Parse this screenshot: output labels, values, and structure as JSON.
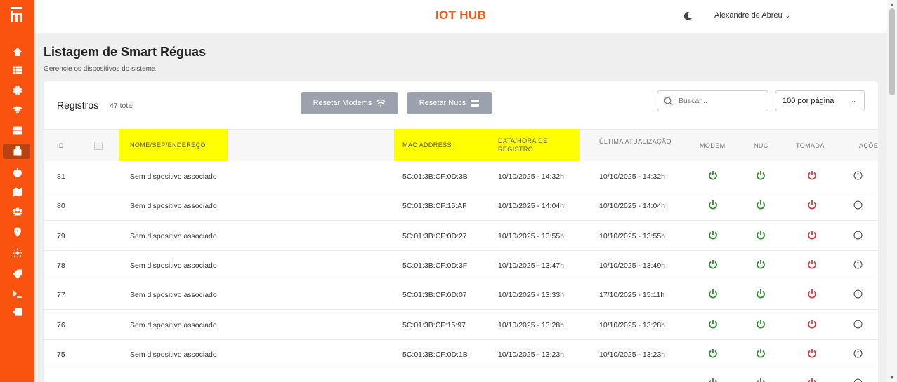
{
  "header": {
    "title": "IOT HUB",
    "user_name": "Alexandre de Abreu"
  },
  "page": {
    "title": "Listagem de Smart Réguas",
    "subtitle": "Gerencie os dispositivos do sistema"
  },
  "toolbar": {
    "registros_label": "Registros",
    "total_label": "47 total",
    "reset_modems_label": "Resetar Modems",
    "reset_nucs_label": "Resetar Nucs",
    "search_placeholder": "Buscar...",
    "per_page_label": "100 por página"
  },
  "table": {
    "columns": {
      "id": "ID",
      "nome": "NOME/SEP/ENDEREÇO",
      "mac": "MAC ADDRESS",
      "data_registro": "DATA/HORA DE REGISTRO",
      "ultima": "ÚLTIMA ATUALIZAÇÃO",
      "modem": "MODEM",
      "nuc": "NUC",
      "tomada": "TOMADA",
      "acoes": "AÇÕES"
    },
    "rows": [
      {
        "id": "81",
        "nome": "Sem dispositivo associado",
        "mac": "5C:01:3B:CF:0D:3B",
        "registro": "10/10/2025 - 14:32h",
        "ultima": "10/10/2025 - 14:32h"
      },
      {
        "id": "80",
        "nome": "Sem dispositivo associado",
        "mac": "5C:01:3B:CF:15:AF",
        "registro": "10/10/2025 - 14:04h",
        "ultima": "10/10/2025 - 14:04h"
      },
      {
        "id": "79",
        "nome": "Sem dispositivo associado",
        "mac": "5C:01:3B:CF:0D:27",
        "registro": "10/10/2025 - 13:55h",
        "ultima": "10/10/2025 - 13:55h"
      },
      {
        "id": "78",
        "nome": "Sem dispositivo associado",
        "mac": "5C:01:3B:CF:0D:3F",
        "registro": "10/10/2025 - 13:47h",
        "ultima": "10/10/2025 - 13:49h"
      },
      {
        "id": "77",
        "nome": "Sem dispositivo associado",
        "mac": "5C:01:3B:CF:0D:07",
        "registro": "10/10/2025 - 13:33h",
        "ultima": "17/10/2025 - 15:11h"
      },
      {
        "id": "76",
        "nome": "Sem dispositivo associado",
        "mac": "5C:01:3B:CF:15:97",
        "registro": "10/10/2025 - 13:28h",
        "ultima": "10/10/2025 - 13:28h"
      },
      {
        "id": "75",
        "nome": "Sem dispositivo associado",
        "mac": "5C:01:3B:CF:0D:1B",
        "registro": "10/10/2025 - 13:23h",
        "ultima": "10/10/2025 - 13:23h"
      }
    ]
  },
  "colors": {
    "accent": "#fa520f",
    "power_on": "#2e8b2e",
    "power_off": "#d63a3a",
    "highlight": "#ffff00"
  },
  "sidebar": {
    "icons": [
      "home-icon",
      "list-icon",
      "chip-icon",
      "wifi-icon",
      "server-icon",
      "smart-plug-icon",
      "power-icon",
      "map-icon",
      "users-icon",
      "location-icon",
      "sun-icon",
      "tag-icon",
      "terminal-icon",
      "logout-icon"
    ]
  }
}
